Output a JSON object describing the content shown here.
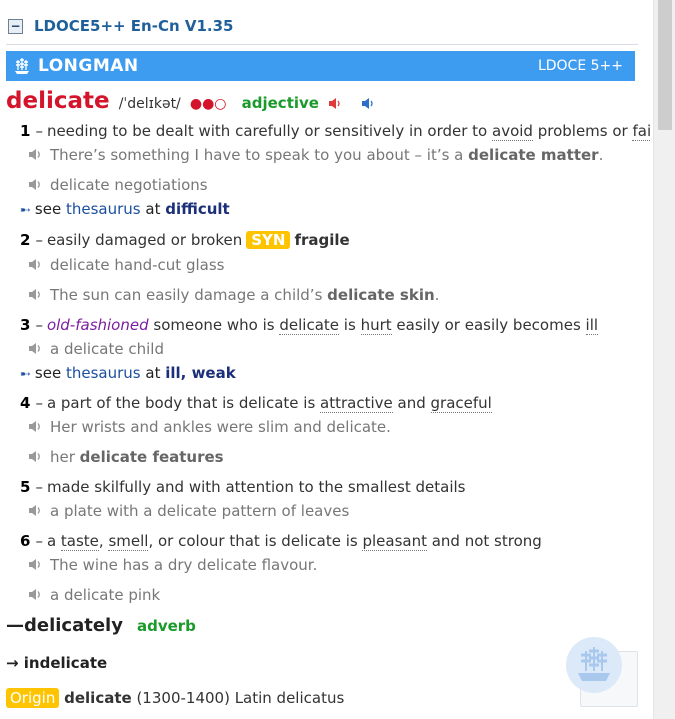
{
  "dictionary": {
    "title": "LDOCE5++ En-Cn V1.35",
    "collapse_symbol": "−"
  },
  "banner": {
    "name": "LONGMAN",
    "version": "LDOCE 5++",
    "color": "#3d9cf0"
  },
  "entry": {
    "headword": "delicate",
    "pronunciation": "/ˈdelɪkət/",
    "frequency_marks": "●●○",
    "pos": "adjective"
  },
  "senses": [
    {
      "num": "1",
      "def_parts": [
        "needing to be dealt with carefully or sensitively in order to ",
        "avoid",
        " problems or ",
        "failure"
      ],
      "examples": [
        {
          "before": "There’s something I have to speak to you about – it’s a ",
          "bold": "delicate matter",
          "after": "."
        },
        {
          "before": "delicate negotiations",
          "bold": "",
          "after": ""
        }
      ],
      "see": {
        "prefix": "see",
        "thesaurus": "thesaurus",
        "at": "at",
        "words": "difficult"
      }
    },
    {
      "num": "2",
      "def_parts": [
        "easily damaged or broken"
      ],
      "syn_label": "SYN",
      "syn_word": "fragile",
      "examples": [
        {
          "before": "delicate hand-cut glass",
          "bold": "",
          "after": ""
        },
        {
          "before": "The sun can easily damage a child’s ",
          "bold": "delicate skin",
          "after": "."
        }
      ]
    },
    {
      "num": "3",
      "register": "old-fashioned",
      "def_parts": [
        " someone who is ",
        "delicate",
        " is ",
        "hurt",
        " easily or easily becomes ",
        "ill"
      ],
      "examples": [
        {
          "before": "a delicate child",
          "bold": "",
          "after": ""
        }
      ],
      "see": {
        "prefix": "see",
        "thesaurus": "thesaurus",
        "at": "at",
        "words": "ill, weak"
      }
    },
    {
      "num": "4",
      "def_parts": [
        "a part of the body that is delicate is ",
        "attractive",
        " and ",
        "graceful"
      ],
      "examples": [
        {
          "before": "Her wrists and ankles were slim and delicate.",
          "bold": "",
          "after": ""
        },
        {
          "before": "her ",
          "bold": "delicate features",
          "after": ""
        }
      ]
    },
    {
      "num": "5",
      "def_parts": [
        "made skilfully and with attention to the smallest details"
      ],
      "examples": [
        {
          "before": "a plate with a delicate pattern of leaves",
          "bold": "",
          "after": ""
        }
      ]
    },
    {
      "num": "6",
      "def_parts": [
        "a ",
        "taste",
        ", ",
        "smell",
        ", or colour that is delicate is ",
        "pleasant",
        " and not strong"
      ],
      "examples": [
        {
          "before": "The wine has a dry delicate flavour.",
          "bold": "",
          "after": ""
        },
        {
          "before": "a delicate pink",
          "bold": "",
          "after": ""
        }
      ]
    }
  ],
  "derivative": {
    "word": "—delicately",
    "pos": "adverb"
  },
  "cross_ref": "→ indelicate",
  "origin": {
    "label": "Origin",
    "word": "delicate",
    "rest": " (1300-1400) Latin delicatus"
  },
  "icons": {
    "speaker": "speaker-icon",
    "arrow": "pointer-arrow-icon",
    "logo": "longman-ship-icon"
  }
}
